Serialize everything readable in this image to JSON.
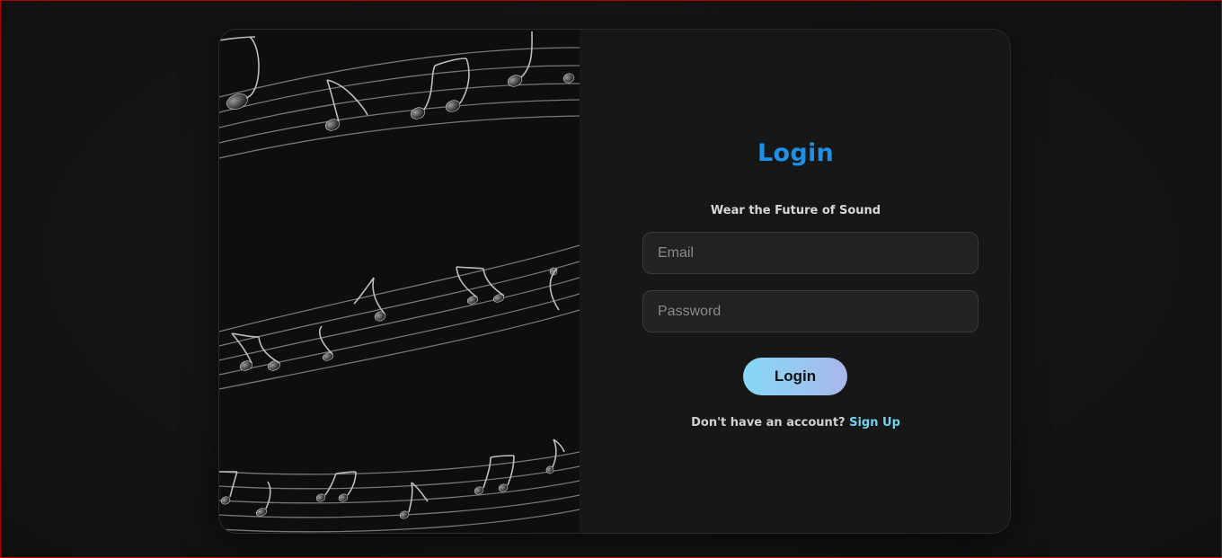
{
  "login": {
    "title": "Login",
    "tagline": "Wear the Future of Sound",
    "email_placeholder": "Email",
    "password_placeholder": "Password",
    "submit_label": "Login",
    "signup_prompt": "Don't have an account?",
    "signup_link": "Sign Up"
  },
  "colors": {
    "accent_title": "#1e90e8",
    "button_gradient_start": "#86d8f5",
    "button_gradient_end": "#a9b7ea",
    "link": "#6fd3ef"
  },
  "illustration": {
    "icon": "music-notes-staff-image"
  }
}
